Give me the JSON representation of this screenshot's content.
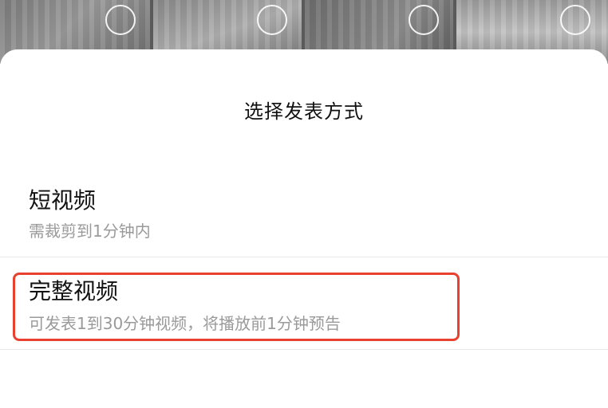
{
  "background": {
    "thumbnails": [
      "photo-thumb",
      "photo-thumb",
      "photo-thumb",
      "photo-thumb"
    ]
  },
  "sheet": {
    "title": "选择发表方式",
    "options": [
      {
        "label": "短视频",
        "description": "需裁剪到1分钟内"
      },
      {
        "label": "完整视频",
        "description": "可发表1到30分钟视频，将播放前1分钟预告"
      }
    ]
  },
  "colors": {
    "highlight": "#e8412f",
    "text_primary": "#111111",
    "text_secondary": "#9a9a9a"
  }
}
